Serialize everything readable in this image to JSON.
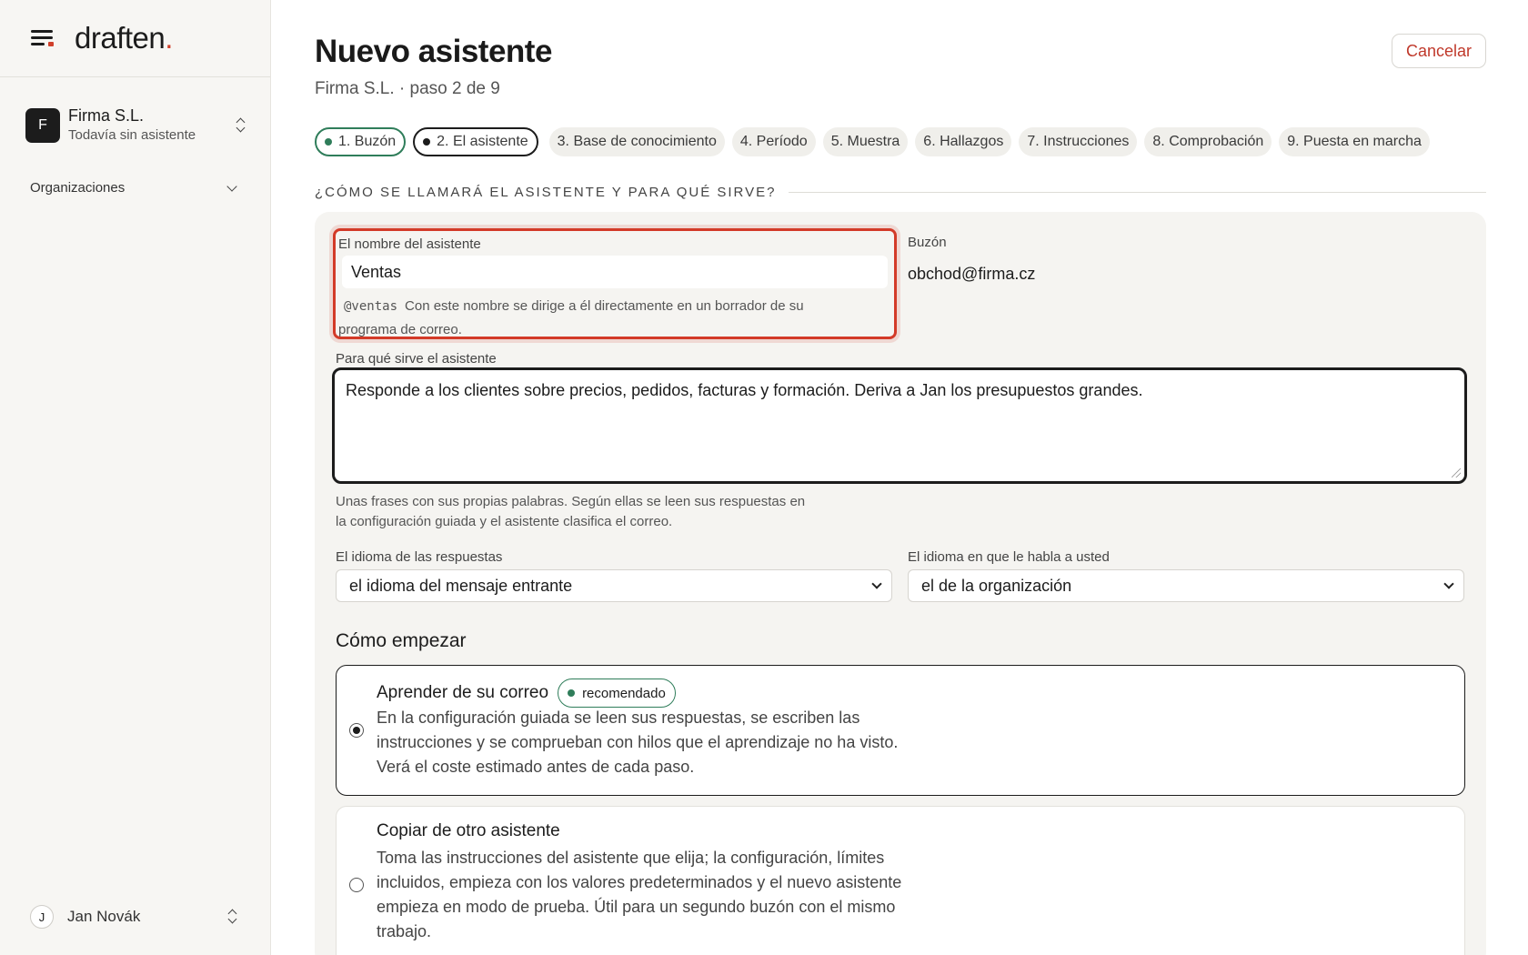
{
  "app": {
    "logo_text": "draften",
    "logo_dot": "."
  },
  "sidebar": {
    "org": {
      "initial": "F",
      "name": "Firma S.L.",
      "subtitle": "Todavía sin asistente"
    },
    "nav_organizations": "Organizaciones",
    "user": {
      "initial": "J",
      "name": "Jan Novák"
    }
  },
  "header": {
    "title": "Nuevo asistente",
    "subtitle": "Firma S.L. · paso 2 de 9",
    "cancel_label": "Cancelar"
  },
  "steps": [
    {
      "label": "1. Buzón",
      "state": "done"
    },
    {
      "label": "2. El asistente",
      "state": "active"
    },
    {
      "label": "3. Base de conocimiento",
      "state": "todo"
    },
    {
      "label": "4. Período",
      "state": "todo"
    },
    {
      "label": "5. Muestra",
      "state": "todo"
    },
    {
      "label": "6. Hallazgos",
      "state": "todo"
    },
    {
      "label": "7. Instrucciones",
      "state": "todo"
    },
    {
      "label": "8. Comprobación",
      "state": "todo"
    },
    {
      "label": "9. Puesta en marcha",
      "state": "todo"
    }
  ],
  "section": {
    "heading": "¿CÓMO SE LLAMARÁ EL ASISTENTE Y PARA QUÉ SIRVE?"
  },
  "form": {
    "name_label": "El nombre del asistente",
    "name_value": "Ventas",
    "handle": "@ventas",
    "name_hint": "Con este nombre se dirige a él directamente en un borrador de su programa de correo.",
    "mailbox_label": "Buzón",
    "mailbox_value": "obchod@firma.cz",
    "purpose_label": "Para qué sirve el asistente",
    "purpose_value": "Responde a los clientes sobre precios, pedidos, facturas y formación. Deriva a Jan los presupuestos grandes.",
    "purpose_hint": "Unas frases con sus propias palabras. Según ellas se leen sus respuestas en la configuración guiada y el asistente clasifica el correo.",
    "reply_lang_label": "El idioma de las respuestas",
    "reply_lang_value": "el idioma del mensaje entrante",
    "ui_lang_label": "El idioma en que le habla a usted",
    "ui_lang_value": "el de la organización"
  },
  "start": {
    "title": "Cómo empezar",
    "options": [
      {
        "title": "Aprender de su correo",
        "badge": "recomendado",
        "selected": true,
        "description": "En la configuración guiada se leen sus respuestas, se escriben las instrucciones y se comprueban con hilos que el aprendizaje no ha visto. Verá el coste estimado antes de cada paso."
      },
      {
        "title": "Copiar de otro asistente",
        "selected": false,
        "description": "Toma las instrucciones del asistente que elija; la configuración, límites incluidos, empieza con los valores predeterminados y el nuevo asistente empieza en modo de prueba. Útil para un segundo buzón con el mismo trabajo."
      }
    ]
  },
  "colors": {
    "accent_red": "#d33a28",
    "success_green": "#2f7d5a",
    "text_dark": "#1c1c1c"
  }
}
